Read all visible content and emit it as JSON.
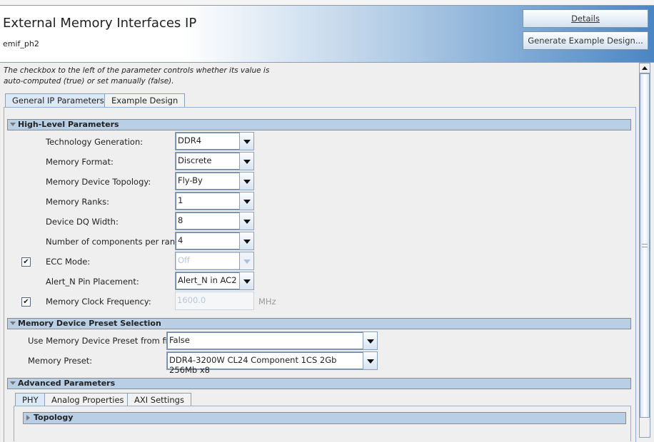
{
  "header": {
    "title": "External Memory Interfaces IP",
    "subtitle": "emif_ph2",
    "details_button": "Details",
    "generate_button": "Generate Example Design..."
  },
  "hint": {
    "line1": "The checkbox to the left of the parameter controls whether its value is",
    "line2": "auto-computed (true) or set manually (false)."
  },
  "tabs": [
    "General IP Parameters",
    "Example Design"
  ],
  "high_level": {
    "title": "High-Level Parameters",
    "rows": [
      {
        "label": "Technology Generation:",
        "value": "DDR4"
      },
      {
        "label": "Memory Format:",
        "value": "Discrete"
      },
      {
        "label": "Memory Device Topology:",
        "value": "Fly-By"
      },
      {
        "label": "Memory Ranks:",
        "value": "1"
      },
      {
        "label": "Device DQ Width:",
        "value": "8"
      },
      {
        "label": "Number of components per rank:",
        "value": "4"
      },
      {
        "label": "ECC Mode:",
        "value": "Off",
        "auto": true
      },
      {
        "label": "Alert_N Pin Placement:",
        "value": "Alert_N in AC2"
      },
      {
        "label": "Memory Clock Frequency:",
        "value": "1600.0",
        "unit": "MHz",
        "auto": true
      }
    ]
  },
  "preset": {
    "title": "Memory Device Preset Selection",
    "use_label": "Use Memory Device Preset from file:",
    "use_value": "False",
    "preset_label": "Memory Preset:",
    "preset_value": "DDR4-3200W CL24 Component 1CS 2Gb 256Mb x8"
  },
  "advanced": {
    "title": "Advanced Parameters",
    "tabs": [
      "PHY",
      "Analog Properties",
      "AXI Settings"
    ],
    "topology": "Topology"
  },
  "checkmark": "✔"
}
